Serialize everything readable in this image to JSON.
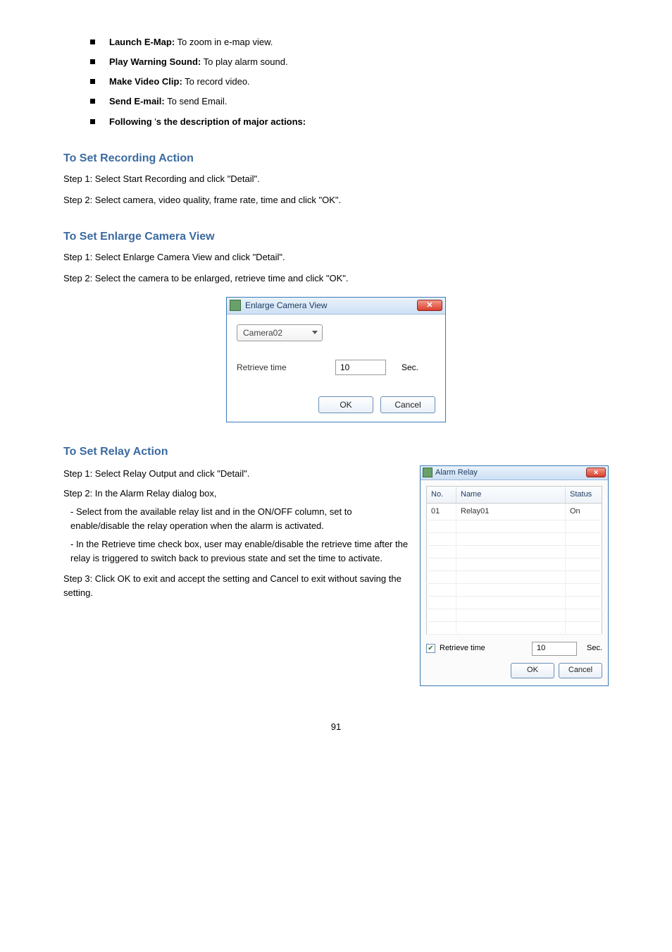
{
  "bullets": {
    "b1": {
      "label": "Launch E-Map:",
      "text": " To zoom in e-map view."
    },
    "b2": {
      "label": "Play Warning Sound:",
      "text": " To play alarm sound."
    },
    "b3": {
      "label": "Make Video Clip:",
      "text": " To record video."
    },
    "b4": {
      "label": "Send E-mail:",
      "text": " To send Email."
    },
    "b5a": "Following ",
    "b5b": "'",
    "b5c": "s the description of major actions:"
  },
  "sectionTitle": "To Set Recording Action",
  "p1": "Step 1: Select Start Recording and click \"Detail\".",
  "p2": "Step 2: Select camera, video quality, frame rate, time and click \"OK\".",
  "sectionTitle2": "To Set Enlarge Camera View",
  "p3": "Step 1: Select Enlarge Camera View and click \"Detail\".",
  "p4": "Step 2: Select the camera to be enlarged, retrieve time and click \"OK\".",
  "dlg1": {
    "title": "Enlarge Camera View",
    "combo": "Camera02",
    "retrieve": "Retrieve time",
    "value": "10",
    "sec": "Sec.",
    "ok": "OK",
    "cancel": "Cancel"
  },
  "sectionTitle3": "To Set Relay Action",
  "dlg2": {
    "title": "Alarm Relay",
    "col_no": "No.",
    "col_name": "Name",
    "col_status": "Status",
    "row_no": "01",
    "row_name": "Relay01",
    "row_status": "On",
    "retrieve": "Retrieve time",
    "value": "10",
    "sec": "Sec.",
    "ok": "OK",
    "cancel": "Cancel"
  },
  "p5": "Step 1: Select Relay Output and click \"Detail\".",
  "p6": "Step 2: In the Alarm Relay dialog box,",
  "d1": "-  Select from the available relay list and in the ON/OFF column, set to enable/disable the relay operation when the alarm is activated.",
  "d2": "-  In the Retrieve time check box, user may enable/disable the retrieve time after the relay is triggered to switch back to previous state and set the time to activate.",
  "p7": "Step 3: Click OK to exit and accept the setting and Cancel to exit without saving the setting.",
  "pageNum": "91"
}
